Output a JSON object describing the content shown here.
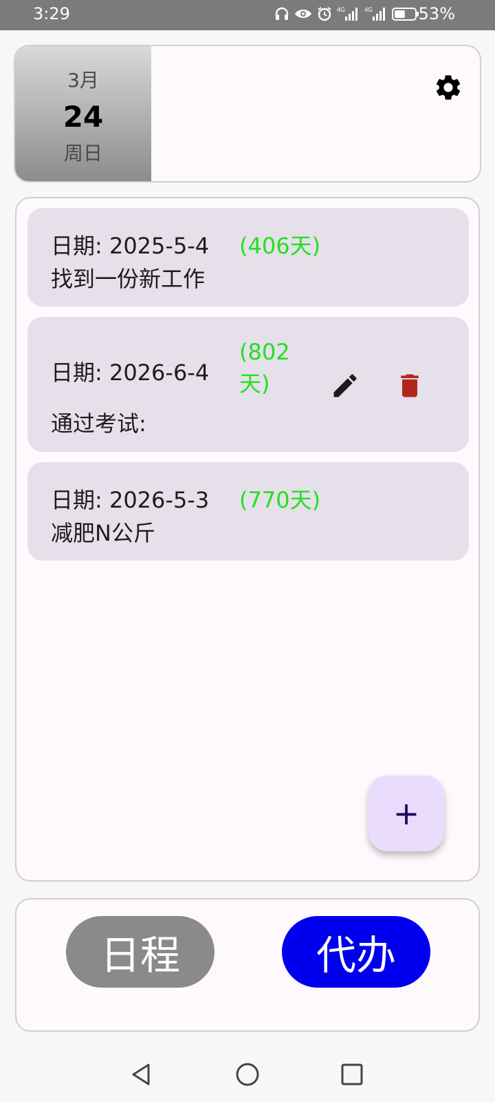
{
  "status_bar": {
    "time": "3:29",
    "battery_percent": "53%",
    "icons": [
      "headphones-icon",
      "eye-icon",
      "alarm-icon",
      "signal-4g-icon",
      "signal-4g-icon",
      "battery-icon"
    ],
    "network_label_1": "4G",
    "network_label_2": "4G",
    "battery_level": 0.53
  },
  "header": {
    "month": "3月",
    "day": "24",
    "weekday": "周日",
    "settings_icon": "gear-icon"
  },
  "todos": [
    {
      "date_label": "日期: 2025-5-4",
      "days": "(406天)",
      "title": "找到一份新工作"
    },
    {
      "date_label": "日期: 2026-6-4",
      "days": "(802天)",
      "title": "通过考试:",
      "edit_icon": "pencil-icon",
      "delete_icon": "trash-icon"
    },
    {
      "date_label": "日期: 2026-5-3",
      "days": "(770天)",
      "title": "减肥N公斤"
    }
  ],
  "fab": {
    "label": "+"
  },
  "bottom_tabs": {
    "schedule_label": "日程",
    "todo_label": "代办"
  },
  "colors": {
    "days_green": "#22e01f",
    "active_tab": "#0000ee",
    "inactive_tab": "#8a8a8a",
    "delete_red": "#b3261e"
  },
  "nav_bar": {
    "icons": [
      "back-icon",
      "home-icon",
      "recents-icon"
    ]
  }
}
